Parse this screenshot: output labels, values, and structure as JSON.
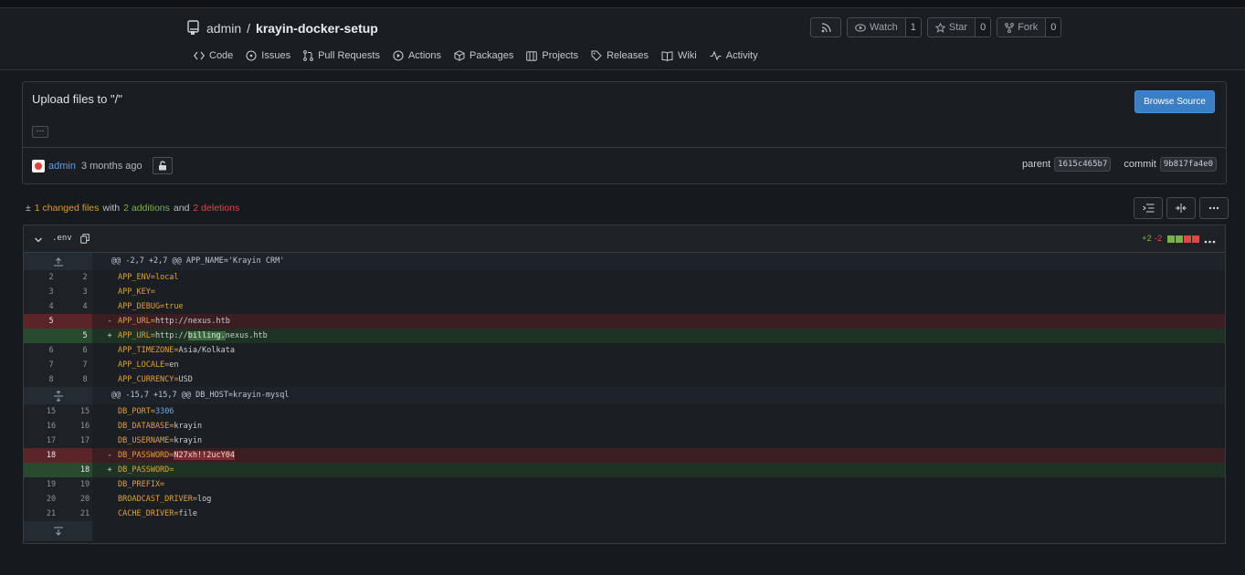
{
  "repo": {
    "owner": "admin",
    "separator": "/",
    "name": "krayin-docker-setup"
  },
  "header_actions": {
    "watch": {
      "label": "Watch",
      "count": "1"
    },
    "star": {
      "label": "Star",
      "count": "0"
    },
    "fork": {
      "label": "Fork",
      "count": "0"
    }
  },
  "nav": [
    {
      "label": "Code",
      "icon": "code-icon"
    },
    {
      "label": "Issues",
      "icon": "issue-icon"
    },
    {
      "label": "Pull Requests",
      "icon": "pull-request-icon"
    },
    {
      "label": "Actions",
      "icon": "play-icon"
    },
    {
      "label": "Packages",
      "icon": "package-icon"
    },
    {
      "label": "Projects",
      "icon": "project-icon"
    },
    {
      "label": "Releases",
      "icon": "tag-icon"
    },
    {
      "label": "Wiki",
      "icon": "book-icon"
    },
    {
      "label": "Activity",
      "icon": "pulse-icon"
    }
  ],
  "commit": {
    "title": "Upload files to \"/\"",
    "ellipsis": "···",
    "browse_label": "Browse Source",
    "author": "admin",
    "time": "3 months ago",
    "parent_label": "parent",
    "parent_sha": "1615c465b7",
    "commit_label": "commit",
    "commit_sha": "9b817fa4e0"
  },
  "stats": {
    "icon": "±",
    "changed": "1 changed files",
    "with": "with",
    "additions": "2 additions",
    "and": "and",
    "deletions": "2 deletions"
  },
  "file": {
    "name": ".env",
    "additions": "+2",
    "deletions": "-2",
    "colors": {
      "add": "#79b04b",
      "del": "#d94a44"
    }
  },
  "hunks": {
    "h1": "@@ -2,7 +2,7 @@ APP_NAME='Krayin CRM'",
    "h2": "@@ -15,7 +15,7 @@ DB_HOST=krayin-mysql"
  },
  "lines": {
    "l2": {
      "o": "2",
      "n": "2",
      "k": "APP_ENV=",
      "v": "local"
    },
    "l3": {
      "o": "3",
      "n": "3",
      "k": "APP_KEY=",
      "v": ""
    },
    "l4": {
      "o": "4",
      "n": "4",
      "k": "APP_DEBUG=",
      "v": "true"
    },
    "l5d": {
      "o": "5",
      "sign": "-",
      "k": "APP_URL=",
      "v": "http://nexus.htb"
    },
    "l5a": {
      "n": "5",
      "sign": "+",
      "k": "APP_URL=",
      "v1": "http://",
      "hl": "billing.",
      "v2": "nexus.htb"
    },
    "l6": {
      "o": "6",
      "n": "6",
      "k": "APP_TIMEZONE=",
      "v": "Asia/Kolkata"
    },
    "l7": {
      "o": "7",
      "n": "7",
      "k": "APP_LOCALE=",
      "v": "en"
    },
    "l8": {
      "o": "8",
      "n": "8",
      "k": "APP_CURRENCY=",
      "v": "USD"
    },
    "l15": {
      "o": "15",
      "n": "15",
      "k": "DB_PORT=",
      "v": "3306"
    },
    "l16": {
      "o": "16",
      "n": "16",
      "k": "DB_DATABASE=",
      "v": "krayin"
    },
    "l17": {
      "o": "17",
      "n": "17",
      "k": "DB_USERNAME=",
      "v": "krayin"
    },
    "l18d": {
      "o": "18",
      "sign": "-",
      "k": "DB_PASSWORD=",
      "hl": "N27xh!!2ucY04"
    },
    "l18a": {
      "n": "18",
      "sign": "+",
      "k": "DB_PASSWORD=",
      "v": ""
    },
    "l19": {
      "o": "19",
      "n": "19",
      "k": "DB_PREFIX=",
      "v": ""
    },
    "l20": {
      "o": "20",
      "n": "20",
      "k": "BROADCAST_DRIVER=",
      "v": "log"
    },
    "l21": {
      "o": "21",
      "n": "21",
      "k": "CACHE_DRIVER=",
      "v": "file"
    }
  }
}
